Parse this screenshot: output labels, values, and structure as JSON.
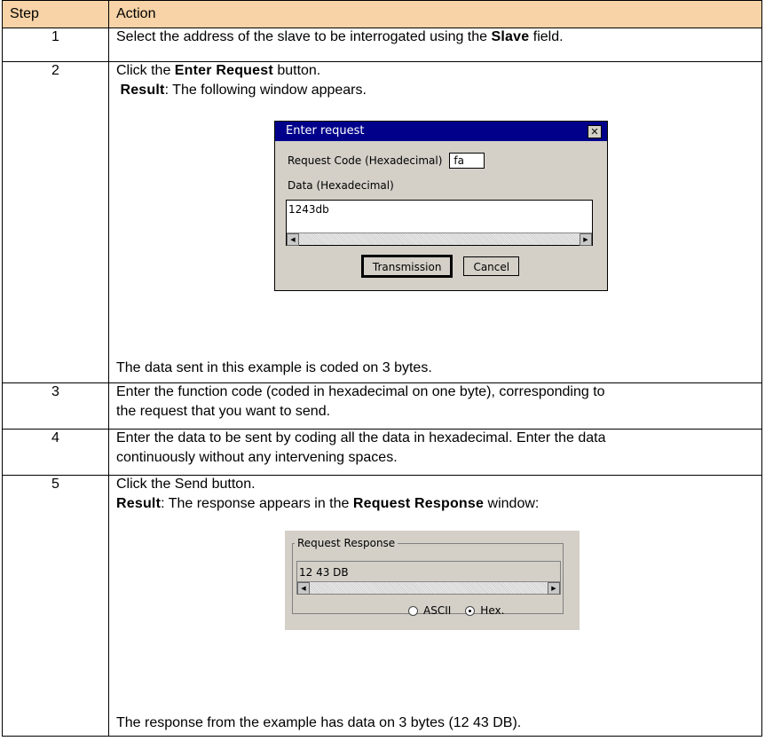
{
  "table": {
    "headers": {
      "step": "Step",
      "action": "Action"
    },
    "rows": [
      {
        "step": "1",
        "pre": "Select the address of the slave to be interrogated using the ",
        "bold": "Slave",
        "post": " field."
      },
      {
        "step": "2",
        "line1_pre": "Click the ",
        "line1_bold": "Enter Request",
        "line1_post": " button.",
        "result_label": "Result",
        "result_text": ": The following window appears.",
        "footer": "The data sent in this example is coded on 3 bytes."
      },
      {
        "step": "3",
        "line1": "Enter the function code (coded in hexadecimal on one byte), corresponding to",
        "line2": "the request that you want to send."
      },
      {
        "step": "4",
        "line1": "Enter the data to be sent by coding all the data in hexadecimal. Enter the data",
        "line2": "continuously without any intervening spaces."
      },
      {
        "step": "5",
        "line1": "Click the Send button.",
        "result_label": "Result",
        "result_pre": ": The response appears in the ",
        "result_bold": "Request Response",
        "result_post": " window:",
        "footer": "The response from the example has data on 3 bytes (12 43 DB)."
      }
    ]
  },
  "enter_request_dialog": {
    "title": "Enter request",
    "close_glyph": "✕",
    "request_code_label": "Request Code (Hexadecimal)",
    "request_code_value": "fa",
    "data_label": "Data (Hexadecimal)",
    "data_value": "1243db",
    "transmission_label": "Transmission",
    "cancel_label": "Cancel"
  },
  "request_response_panel": {
    "legend": "Request Response",
    "value": "12 43 DB",
    "radio_ascii": "ASCII",
    "radio_hex": "Hex.",
    "selected": "Hex."
  },
  "colors": {
    "header_bg": "#f7d3a7",
    "dialog_title_bg": "#00008b",
    "dialog_bg": "#d4d0c8"
  }
}
